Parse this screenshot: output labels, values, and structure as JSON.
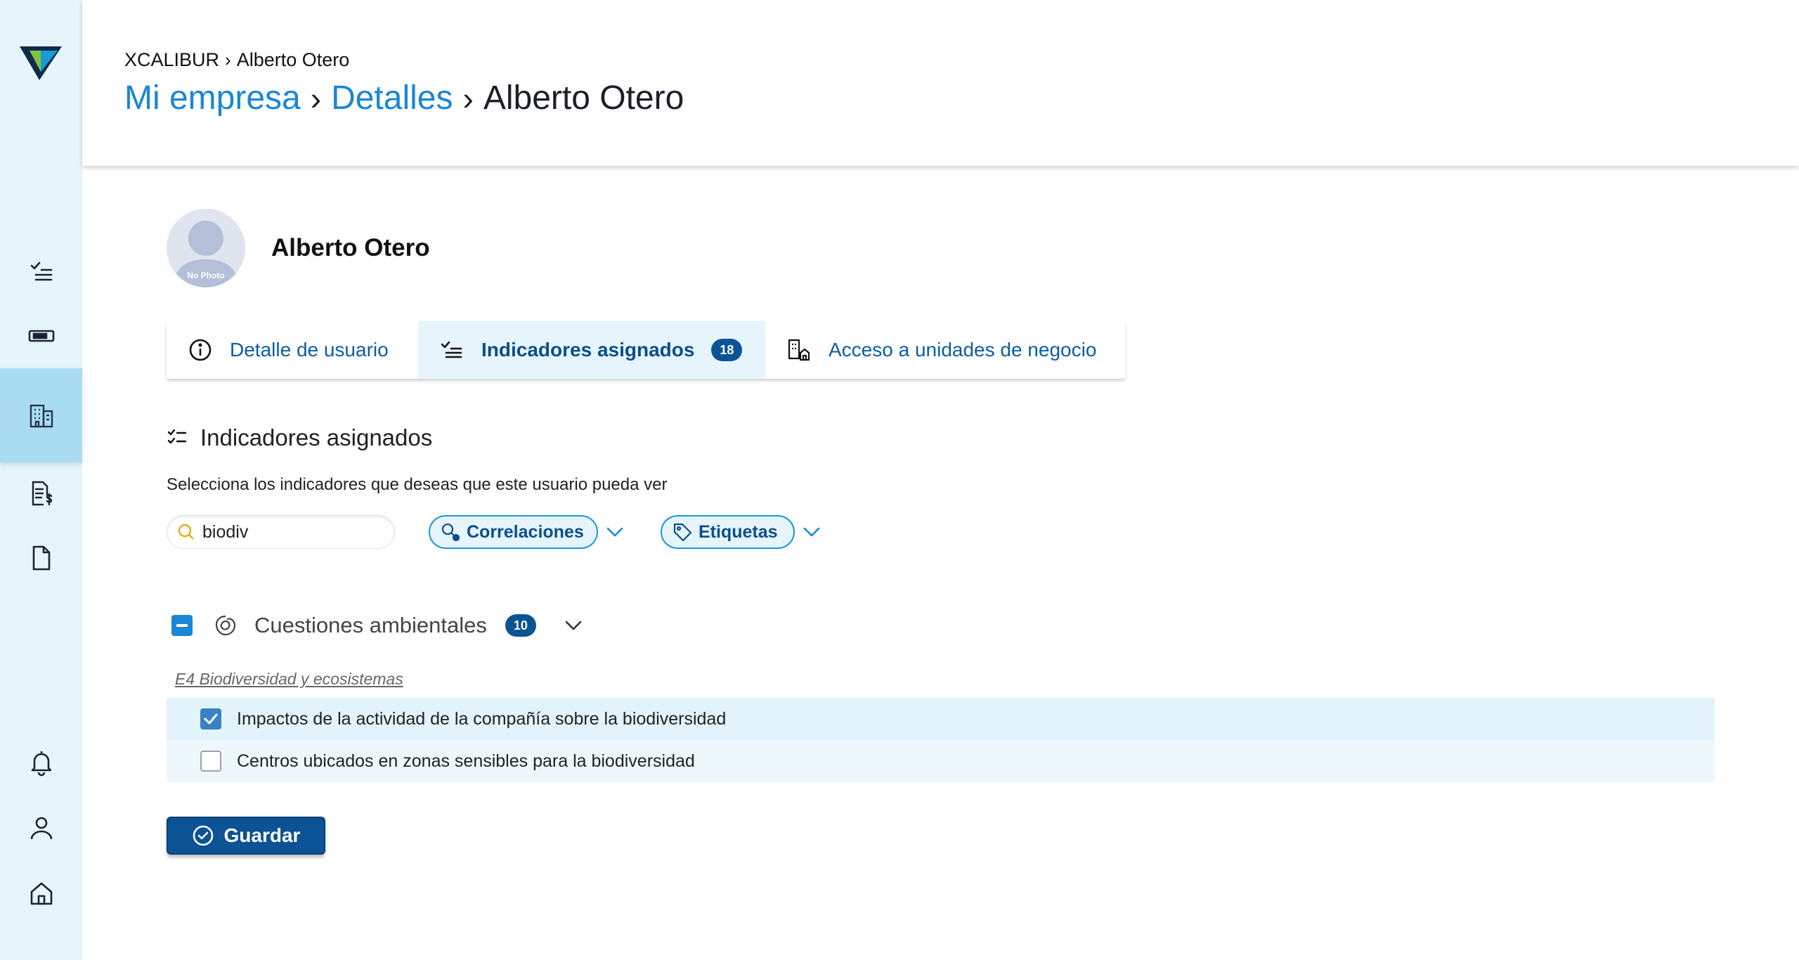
{
  "breadcrumb": {
    "small": [
      "XCALIBUR",
      "Alberto Otero"
    ],
    "big": [
      "Mi empresa",
      "Detalles",
      "Alberto Otero"
    ]
  },
  "sidebar": {
    "items": [
      {
        "icon": "checklist-icon"
      },
      {
        "icon": "card-icon"
      },
      {
        "icon": "building-icon",
        "active": true
      },
      {
        "icon": "invoice-icon"
      },
      {
        "icon": "document-icon"
      },
      {
        "icon": "bell-icon"
      },
      {
        "icon": "user-icon"
      },
      {
        "icon": "home-icon"
      }
    ]
  },
  "user": {
    "name": "Alberto Otero",
    "avatar_text": "No Photo"
  },
  "tabs": [
    {
      "label": "Detalle de usuario",
      "icon": "info-icon"
    },
    {
      "label": "Indicadores asignados",
      "icon": "checklist-icon",
      "badge": "18",
      "active": true
    },
    {
      "label": "Acceso a unidades de negocio",
      "icon": "buildings-icon"
    }
  ],
  "section": {
    "title": "Indicadores asignados",
    "description": "Selecciona los indicadores que deseas que este usuario pueda ver"
  },
  "search": {
    "value": "biodiv"
  },
  "filters": {
    "correlaciones": "Correlaciones",
    "etiquetas": "Etiquetas"
  },
  "group": {
    "label": "Cuestiones ambientales",
    "badge": "10",
    "subcategory": "E4 Biodiversidad y ecosistemas",
    "items": [
      {
        "label": "Impactos de la actividad de la compañía sobre la biodiversidad",
        "checked": true
      },
      {
        "label": "Centros ubicados en zonas sensibles para la biodiversidad",
        "checked": false
      }
    ]
  },
  "actions": {
    "save_label": "Guardar"
  },
  "colors": {
    "sidebar_bg": "#e6f4fb",
    "sidebar_active": "#a9dcf3",
    "primary": "#0b5394",
    "link": "#1a86d6"
  }
}
